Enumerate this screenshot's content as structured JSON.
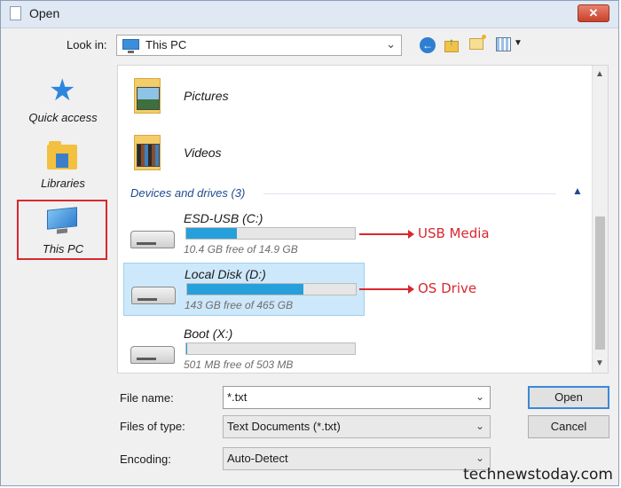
{
  "window": {
    "title": "Open",
    "close_glyph": "✕"
  },
  "toolbar": {
    "look_in_label": "Look in:",
    "look_in_value": "This PC",
    "icons": [
      "back-arrow-icon",
      "up-folder-icon",
      "new-folder-icon",
      "view-menu-icon"
    ]
  },
  "places": [
    {
      "label": "Quick access",
      "icon": "star-icon"
    },
    {
      "label": "Libraries",
      "icon": "libraries-folder-icon"
    },
    {
      "label": "This PC",
      "icon": "computer-icon",
      "selected": true
    }
  ],
  "folders": [
    {
      "label": "Pictures",
      "icon": "pictures-folder-icon"
    },
    {
      "label": "Videos",
      "icon": "videos-folder-icon"
    }
  ],
  "devices": {
    "header": "Devices and drives (3)",
    "drives": [
      {
        "label": "ESD-USB (C:)",
        "free": "10.4 GB free of 14.9 GB",
        "used_fraction": 0.3,
        "selected": false
      },
      {
        "label": "Local Disk (D:)",
        "free": "143 GB free of 465 GB",
        "used_fraction": 0.69,
        "selected": true
      },
      {
        "label": "Boot (X:)",
        "free": "501 MB free of 503 MB",
        "used_fraction": 0.004,
        "selected": false
      }
    ]
  },
  "annotations": {
    "usb": "USB Media",
    "os": "OS Drive",
    "color": "#d9282f"
  },
  "form": {
    "file_name_label": "File name:",
    "file_name_value": "*.txt",
    "file_type_label": "Files of type:",
    "file_type_value": "Text Documents (*.txt)",
    "encoding_label": "Encoding:",
    "encoding_value": "Auto-Detect"
  },
  "buttons": {
    "open": "Open",
    "cancel": "Cancel"
  },
  "watermark": "technewstoday.com",
  "colors": {
    "accent": "#26a0da",
    "selection": "#cde8fa"
  }
}
